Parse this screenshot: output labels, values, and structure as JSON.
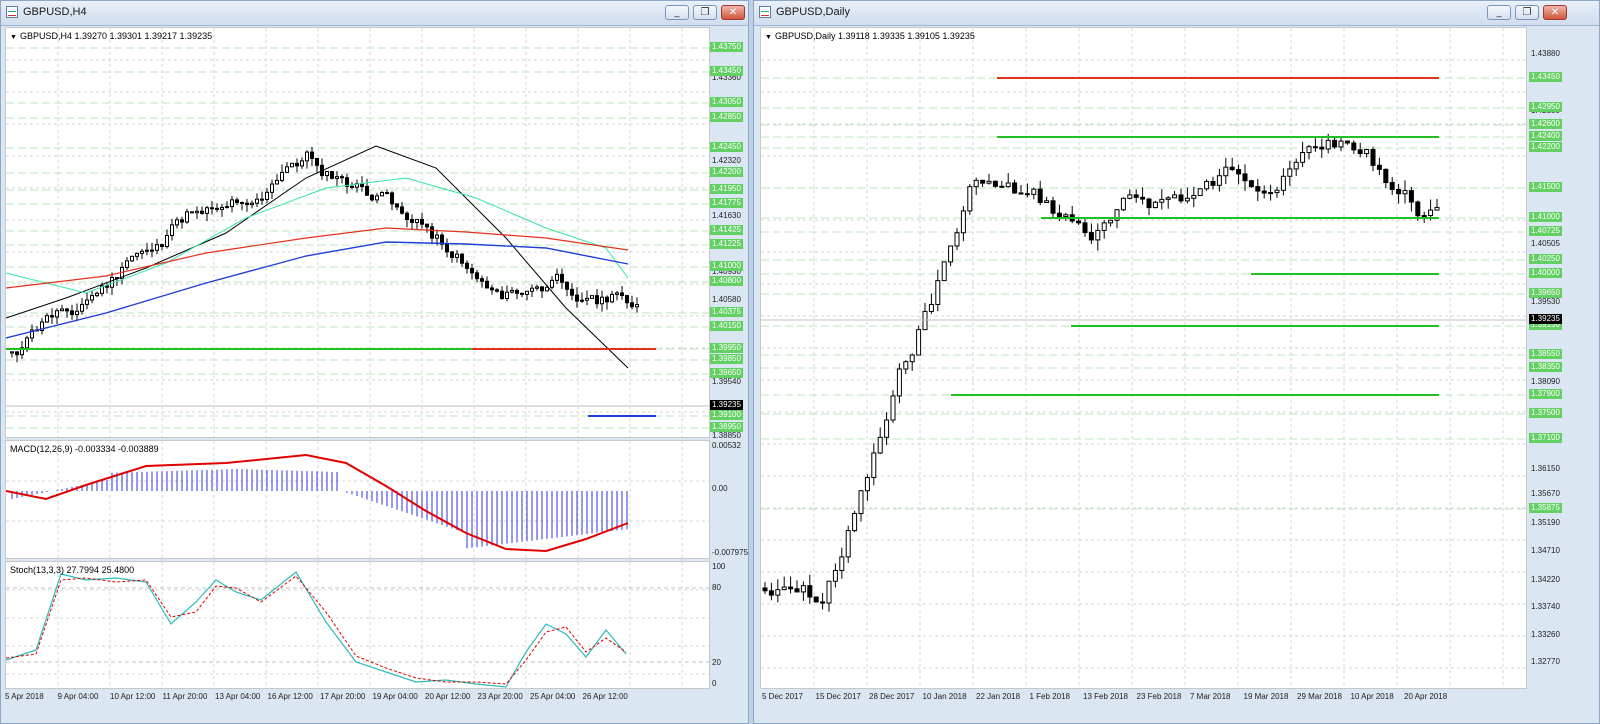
{
  "left_window": {
    "title": "GBPUSD,H4",
    "main_label": "GBPUSD,H4  1.39270 1.39301 1.39217 1.39235",
    "price_ticks": [
      "1.43360",
      "1.42320",
      "1.41630",
      "1.40930",
      "1.40580",
      "1.40240",
      "1.39540",
      "1.38850"
    ],
    "level_tags": [
      "1.43750",
      "1.43450",
      "1.43050",
      "1.42850",
      "1.42450",
      "1.42200",
      "1.41950",
      "1.41775",
      "1.41425",
      "1.41225",
      "1.41000",
      "1.40800",
      "1.40375",
      "1.40150",
      "1.39950",
      "1.39850",
      "1.39650",
      "1.39100",
      "1.38950"
    ],
    "current_price_tag": "1.39235",
    "macd_label": "MACD(12,26,9) -0.003334 -0.003889",
    "macd_ticks": [
      "0.00532",
      "0.00",
      "-0.007975"
    ],
    "stoch_label": "Stoch(13,3,3) 27.7994 25.4800",
    "stoch_ticks": [
      "100",
      "80",
      "20",
      "0"
    ],
    "x_labels": [
      "5 Apr 2018",
      "9 Apr 04:00",
      "10 Apr 12:00",
      "11 Apr 20:00",
      "13 Apr 04:00",
      "16 Apr 12:00",
      "17 Apr 20:00",
      "19 Apr 04:00",
      "20 Apr 12:00",
      "23 Apr 20:00",
      "25 Apr 04:00",
      "26 Apr 12:00"
    ]
  },
  "right_window": {
    "title": "GBPUSD,Daily",
    "main_label": "GBPUSD,Daily  1.39118 1.39335 1.39105 1.39235",
    "price_ticks": [
      "1.43880",
      "1.43470",
      "1.42550",
      "1.41950",
      "1.40505",
      "1.39530",
      "1.38090",
      "1.36640",
      "1.36150",
      "1.35670",
      "1.35190",
      "1.34710",
      "1.34220",
      "1.33740",
      "1.33260",
      "1.32770"
    ],
    "level_tags": [
      "1.43450",
      "1.42950",
      "1.42600",
      "1.42400",
      "1.42200",
      "1.41500",
      "1.41000",
      "1.40725",
      "1.40250",
      "1.40000",
      "1.39650",
      "1.39150",
      "1.38550",
      "1.38350",
      "1.37900",
      "1.37500",
      "1.37100",
      "1.35875"
    ],
    "current_price_tag": "1.39235",
    "x_labels": [
      "5 Dec 2017",
      "15 Dec 2017",
      "28 Dec 2017",
      "10 Jan 2018",
      "22 Jan 2018",
      "1 Feb 2018",
      "13 Feb 2018",
      "23 Feb 2018",
      "7 Mar 2018",
      "19 Mar 2018",
      "29 Mar 2018",
      "10 Apr 2018",
      "20 Apr 2018"
    ]
  },
  "window_buttons": {
    "minimize": "_",
    "restore": "❐",
    "close": "✕"
  },
  "colors": {
    "bull_candle": "#ffffff",
    "bear_candle": "#000000",
    "support_line": "#23c023",
    "resistance_line": "#e2311d",
    "ma_fast": "#000000",
    "ma_mid": "#35e6a8",
    "ma_slow": "#e2311d",
    "ma_long": "#1f3fd6",
    "macd_hist": "#3030e0",
    "macd_signal": "#e00000",
    "stoch_main": "#2bbbbb",
    "stoch_signal": "#e00000",
    "grid": "#bfe6bf"
  }
}
